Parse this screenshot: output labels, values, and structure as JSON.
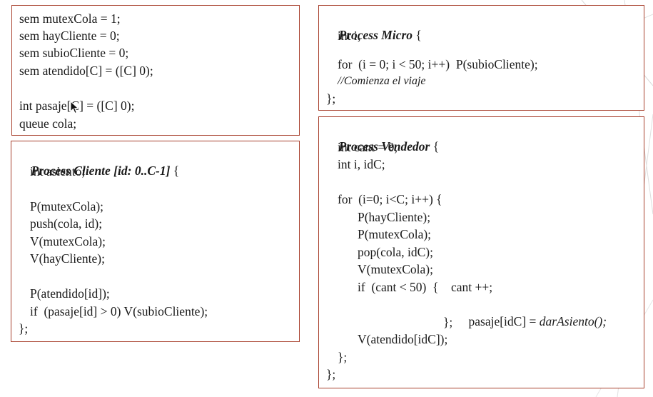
{
  "colors": {
    "border": "#a8402d",
    "text": "#1a1a1a",
    "background": "#ffffff"
  },
  "declarations": {
    "lines": [
      "sem mutexCola = 1;",
      "sem hayCliente = 0;",
      "sem subioCliente = 0;",
      "sem atendido[C] = ([C] 0);",
      "int pasaje[C] = ([C] 0);",
      "queue cola;"
    ]
  },
  "cliente": {
    "header_kw": "Process Cliente [id: 0..C-1]",
    "header_brace": " {",
    "lines": [
      "int asiento;",
      "P(mutexCola);",
      "push(cola, id);",
      "V(mutexCola);",
      "V(hayCliente);",
      "P(atendido[id]);",
      "if  (pasaje[id] > 0) V(subioCliente);",
      "};"
    ]
  },
  "micro": {
    "header_kw": "Process Micro",
    "header_brace": " {",
    "lines": [
      "int i;",
      "for  (i = 0; i < 50; i++)  P(subioCliente);",
      "//Comienza el viaje",
      "};"
    ]
  },
  "vendedor": {
    "header_kw": "Process Vendedor",
    "header_brace": " {",
    "lines": [
      "int cant = 0;",
      "int i, idC;",
      "for  (i=0; i<C; i++) {",
      "P(hayCliente);",
      "P(mutexCola);",
      "pop(cola, idC);",
      "V(mutexCola);",
      "if  (cant < 50)  {    cant ++;",
      "pasaje[idC] = ",
      "darAsiento();",
      "};",
      "V(atendido[idC]);",
      "};",
      "};"
    ]
  }
}
